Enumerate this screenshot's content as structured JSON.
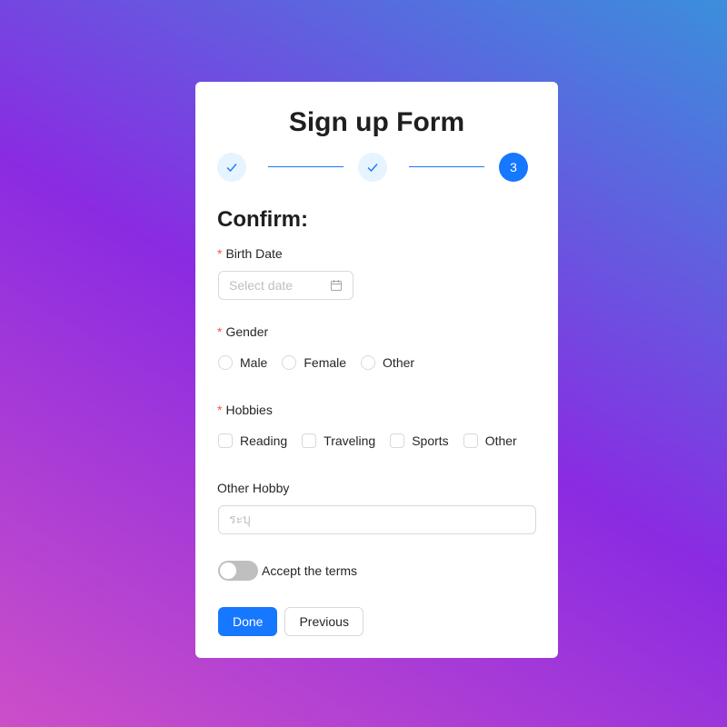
{
  "form": {
    "title": "Sign up Form",
    "steps": [
      {
        "status": "finished",
        "icon": "check-icon"
      },
      {
        "status": "finished",
        "icon": "check-icon"
      },
      {
        "status": "active",
        "number": "3"
      }
    ],
    "section_title": "Confirm:",
    "birth_date": {
      "required_mark": "*",
      "label": "Birth Date",
      "placeholder": "Select date",
      "icon": "calendar-icon"
    },
    "gender": {
      "required_mark": "*",
      "label": "Gender",
      "options": [
        "Male",
        "Female",
        "Other"
      ],
      "selected": null
    },
    "hobbies": {
      "required_mark": "*",
      "label": "Hobbies",
      "options": [
        "Reading",
        "Traveling",
        "Sports",
        "Other"
      ],
      "checked": []
    },
    "other_hobby": {
      "label": "Other Hobby",
      "placeholder": "ระบุ",
      "value": ""
    },
    "terms": {
      "label": "Accept the terms",
      "checked": false
    },
    "buttons": {
      "done": "Done",
      "previous": "Previous"
    }
  },
  "colors": {
    "primary": "#1677ff",
    "required": "#ff4d4f",
    "step_done_bg": "#e6f4ff",
    "toggle_off": "#bfbfbf"
  }
}
